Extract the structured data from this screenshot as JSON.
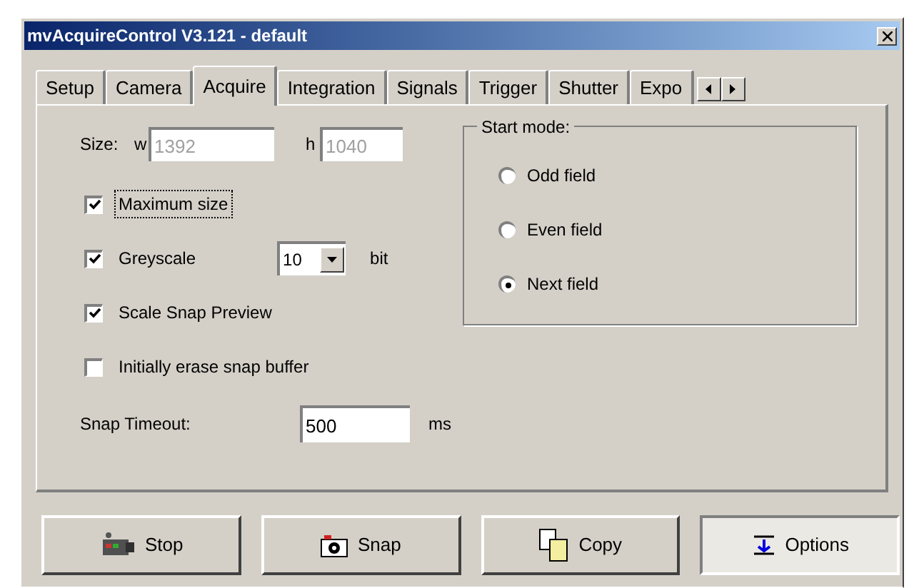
{
  "window": {
    "title": "mvAcquireControl  V3.121 - default"
  },
  "tabs": [
    {
      "label": "Setup",
      "selected": false
    },
    {
      "label": "Camera",
      "selected": false
    },
    {
      "label": "Acquire",
      "selected": true
    },
    {
      "label": "Integration",
      "selected": false
    },
    {
      "label": "Signals",
      "selected": false
    },
    {
      "label": "Trigger",
      "selected": false
    },
    {
      "label": "Shutter",
      "selected": false
    },
    {
      "label": "Expo",
      "selected": false
    }
  ],
  "size": {
    "label": "Size:",
    "width_label": "w",
    "width_value": "1392",
    "height_label": "h",
    "height_value": "1040",
    "disabled": true
  },
  "checkboxes": [
    {
      "label": "Maximum size",
      "checked": true,
      "focused": true
    },
    {
      "label": "Greyscale",
      "checked": true,
      "focused": false,
      "select": {
        "value": "10"
      },
      "unit": "bit"
    },
    {
      "label": "Scale Snap Preview",
      "checked": true,
      "focused": false
    },
    {
      "label": "Initially erase snap buffer",
      "checked": false,
      "focused": false
    }
  ],
  "snap_timeout": {
    "label": "Snap Timeout:",
    "value": "500",
    "unit": "ms"
  },
  "start_mode": {
    "title": "Start mode:",
    "options": [
      {
        "label": "Odd field",
        "selected": false
      },
      {
        "label": "Even field",
        "selected": false
      },
      {
        "label": "Next field",
        "selected": true
      }
    ]
  },
  "buttons": [
    {
      "kind": "stop",
      "label": "Stop",
      "pressed": false
    },
    {
      "kind": "snap",
      "label": "Snap",
      "pressed": false
    },
    {
      "kind": "copy",
      "label": "Copy",
      "pressed": false
    },
    {
      "kind": "options",
      "label": "Options",
      "pressed": true
    }
  ]
}
